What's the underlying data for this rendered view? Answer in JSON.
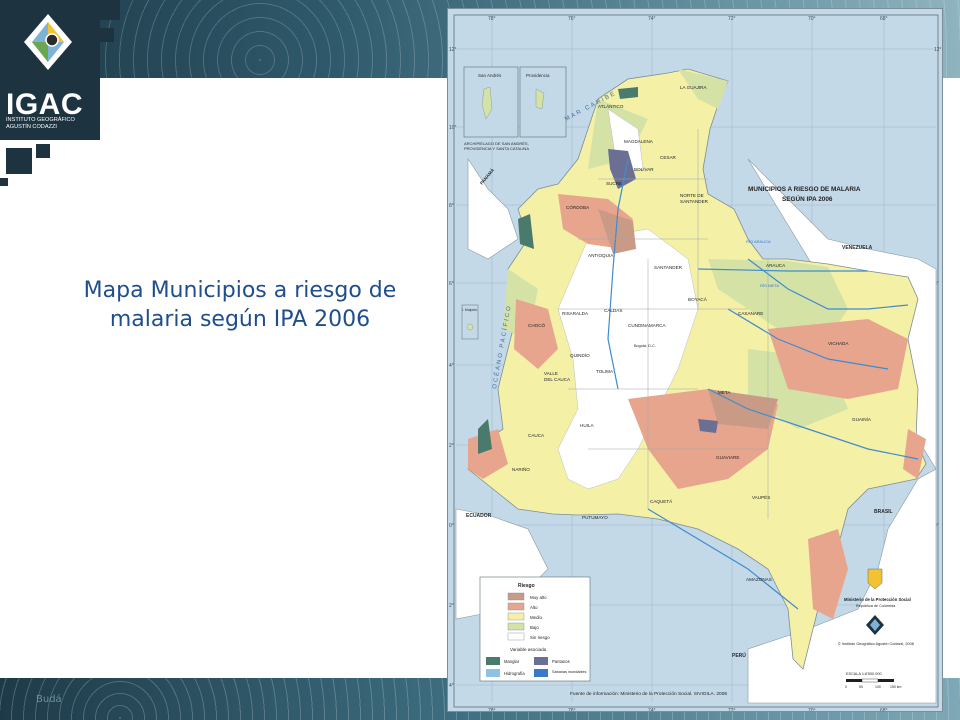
{
  "slide": {
    "title_line1": "Mapa Municipios a riesgo de",
    "title_line2": "malaria según IPA 2006",
    "bottom_faint_text": "Budá"
  },
  "logo": {
    "name": "IGAC",
    "sub_line1": "INSTITUTO GEOGRÁFICO",
    "sub_line2": "AGUSTÍN CODAZZI"
  },
  "map": {
    "title_line1": "MUNICIPIOS A RIESGO DE MALARIA",
    "title_line2": "SEGÚN IPA 2006",
    "sea_caribbean": "MAR CARIBE",
    "sea_pacific": "OCÉANO PACÍFICO",
    "countries": {
      "panama": "PANAMÁ",
      "venezuela": "VENEZUELA",
      "ecuador": "ECUADOR",
      "peru": "PERÚ",
      "brasil": "BRASIL"
    },
    "insets": {
      "san_andres": "San Andrés",
      "providencia": "Providencia",
      "archipelago_line1": "ARCHIPIÉLAGO DE SAN ANDRÉS,",
      "archipelago_line2": "PROVIDENCIA Y SANTA CATALINA",
      "malpelo": "I. Malpelo"
    },
    "departments": {
      "guajira": "LA GUAJIRA",
      "atlantico": "ATLÁNTICO",
      "magdalena": "MAGDALENA",
      "cesar": "CESAR",
      "sucre": "SUCRE",
      "bolivar": "BOLÍVAR",
      "cordoba": "CÓRDOBA",
      "norte_santander_1": "NORTE DE",
      "norte_santander_2": "SANTANDER",
      "antioquia": "ANTIOQUIA",
      "santander": "SANTANDER",
      "arauca": "ARAUCA",
      "boyaca": "BOYACÁ",
      "casanare": "CASANARE",
      "choco": "CHOCÓ",
      "risaralda": "RISARALDA",
      "caldas": "CALDAS",
      "cundinamarca": "CUNDINAMARCA",
      "bogota": "Bogotá, D.C.",
      "quindio": "QUINDÍO",
      "valle_1": "VALLE",
      "valle_2": "DEL CAUCA",
      "tolima": "TOLIMA",
      "vichada": "VICHADA",
      "meta": "META",
      "cauca": "CAUCA",
      "huila": "HUILA",
      "guainia": "GUAINÍA",
      "narino": "NARIÑO",
      "guaviare": "GUAVIARE",
      "caqueta": "CAQUETÁ",
      "vaupes": "VAUPÉS",
      "putumayo": "PUTUMAYO",
      "amazonas": "AMAZONAS"
    },
    "rivers": {
      "arauca": "RÍO ARAUCA",
      "meta": "RÍO META"
    },
    "ticks_top": [
      "78°",
      "76°",
      "74°",
      "72°",
      "70°",
      "68°"
    ],
    "ticks_left": [
      "12°",
      "10°",
      "8°",
      "6°",
      "4°",
      "2°",
      "0°",
      "2°",
      "4°"
    ],
    "legend": {
      "title": "Riesgo",
      "items": [
        {
          "label": "Muy alto",
          "color": "#c99a86"
        },
        {
          "label": "Alto",
          "color": "#e7a58e"
        },
        {
          "label": "Medio",
          "color": "#f4f0a6"
        },
        {
          "label": "Bajo",
          "color": "#d4e2a6"
        },
        {
          "label": "Sin riesgo",
          "color": "#ffffff"
        }
      ],
      "variable_title": "Variable asociada",
      "variables": [
        {
          "label": "Manglar",
          "color": "#4a7a6b"
        },
        {
          "label": "Pantanos",
          "color": "#6a6f93"
        },
        {
          "label": "Hidrografía",
          "color": "#8fc1e3"
        },
        {
          "label": "Sabanas inundables",
          "color": "#3a79c9"
        }
      ]
    },
    "ministry_line1": "Ministerio de la Protección Social",
    "ministry_line2": "República de Colombia",
    "copyright": "© Instituto Geográfico Agustín Codazzi, 2008",
    "scale_title": "ESCALA 1:6'500.000",
    "scale_values": [
      "0",
      "50",
      "100",
      "150 km"
    ],
    "source": "Fuente de información: Ministerio de la Protección Social. SIVIGILA. 2006"
  }
}
